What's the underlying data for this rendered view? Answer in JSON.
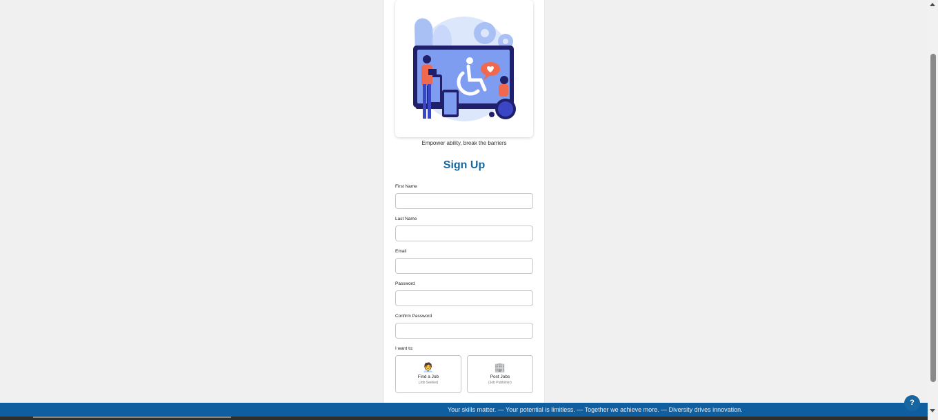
{
  "hero": {
    "image_name": "accessibility-illustration",
    "tagline": "Empower ability, break the barriers"
  },
  "form": {
    "title": "Sign Up",
    "fields": [
      {
        "label": "First Name",
        "value": ""
      },
      {
        "label": "Last Name",
        "value": ""
      },
      {
        "label": "Email",
        "value": ""
      },
      {
        "label": "Password",
        "value": ""
      },
      {
        "label": "Confirm Password",
        "value": ""
      }
    ],
    "role_label": "I want to:",
    "roles": [
      {
        "icon": "person-icon",
        "emoji": "🧑‍💼",
        "title": "Find a Job",
        "subtitle": "(Job Seeker)"
      },
      {
        "icon": "building-icon",
        "emoji": "🏢",
        "title": "Post Jobs",
        "subtitle": "(Job Publisher)"
      }
    ]
  },
  "banner": {
    "text": "Your skills matter. — Your potential is limitless. — Together we achieve more. — Diversity drives innovation."
  },
  "help": {
    "label": "?"
  },
  "colors": {
    "accent": "#1766a0",
    "banner": "#0f5fa0",
    "page_bg": "#f0f0f0"
  }
}
